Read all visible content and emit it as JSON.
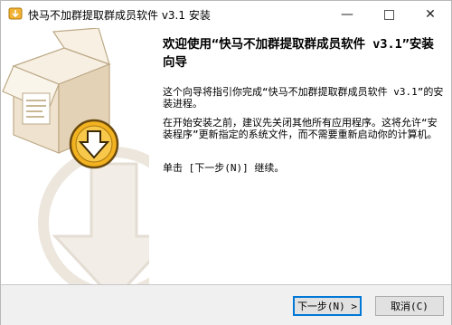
{
  "window": {
    "title": "快马不加群提取群成员软件 v3.1 安装",
    "controls": {
      "minimize": "—",
      "close": "✕"
    }
  },
  "icons": {
    "app": "installer-icon",
    "sidebar": "box-download-icon"
  },
  "content": {
    "heading": "欢迎使用“快马不加群提取群成员软件 v3.1”安装向导",
    "paragraph1": "这个向导将指引你完成“快马不加群提取群成员软件 v3.1”的安装进程。",
    "paragraph2": "在开始安装之前，建议先关闭其他所有应用程序。这将允许“安装程序”更新指定的系统文件，而不需要重新启动你的计算机。",
    "paragraph3": "单击 [下一步(N)] 继续。"
  },
  "buttons": {
    "next": "下一步(N) >",
    "cancel": "取消(C)"
  },
  "colors": {
    "sidebar_bg": "#ffffff",
    "accent": "#0078d7",
    "footer_bg": "#f0f0f0"
  }
}
